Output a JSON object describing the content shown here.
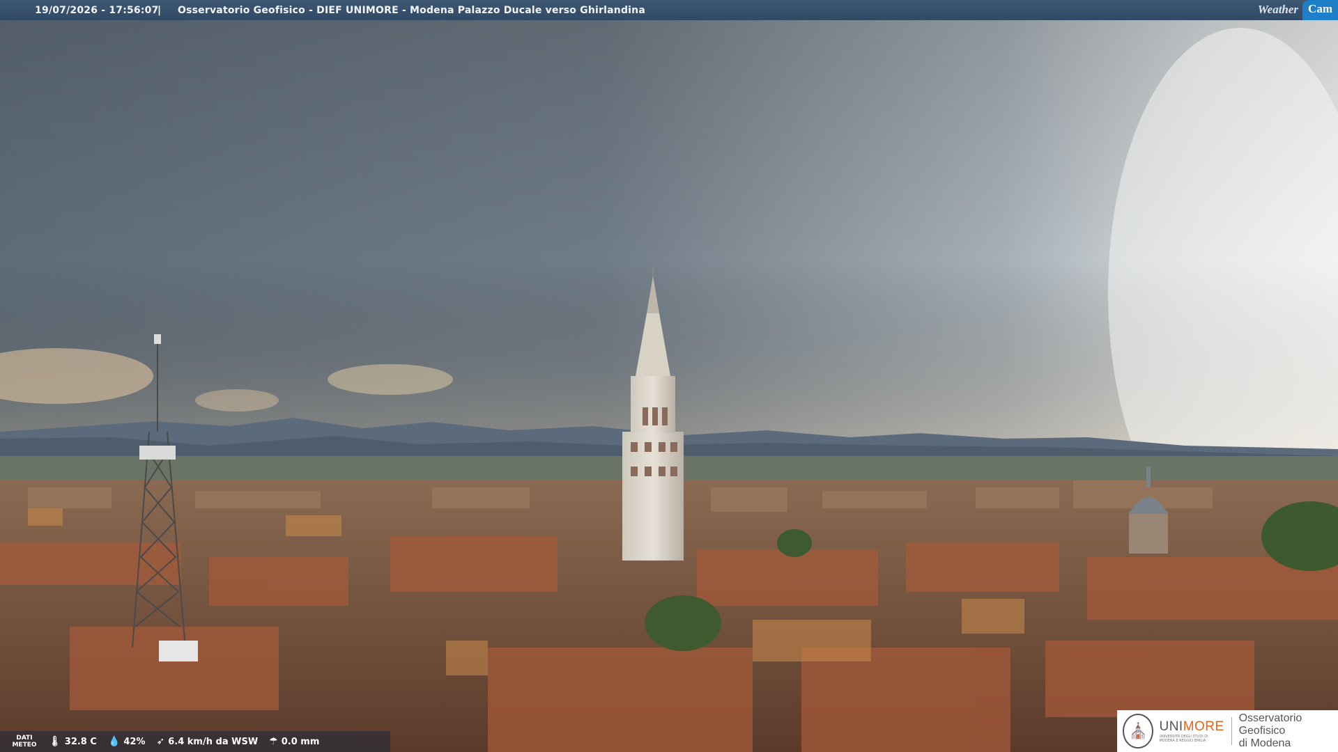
{
  "header": {
    "timestamp": "19/07/2026 - 17:56:07",
    "separator": "|",
    "title": "Osservatorio Geofisico - DIEF UNIMORE - Modena Palazzo Ducale verso Ghirlandina"
  },
  "logo": {
    "weather": "Weather",
    "cam": "Cam"
  },
  "weather_bar": {
    "label_line1": "DATI",
    "label_line2": "METEO",
    "temperature": "32.8 C",
    "humidity": "42%",
    "wind": "6.4 km/h da WSW",
    "rain": "0.0 mm"
  },
  "institution": {
    "name_plain": "UNI",
    "name_accent": "MORE",
    "subtitle_line1": "UNIVERSITÀ DEGLI STUDI DI",
    "subtitle_line2": "MODENA E REGGIO EMILIA",
    "observatory_line1": "Osservatorio Geofisico",
    "observatory_line2": "di Modena"
  },
  "icons": [
    "thermometer-icon",
    "humidity-drop-icon",
    "wind-icon",
    "rain-gauge-icon",
    "university-seal-icon"
  ],
  "colors": {
    "header_bar": "#3a5470",
    "cam_badge": "#1e7fc8",
    "unimore_orange": "#e0661a"
  }
}
